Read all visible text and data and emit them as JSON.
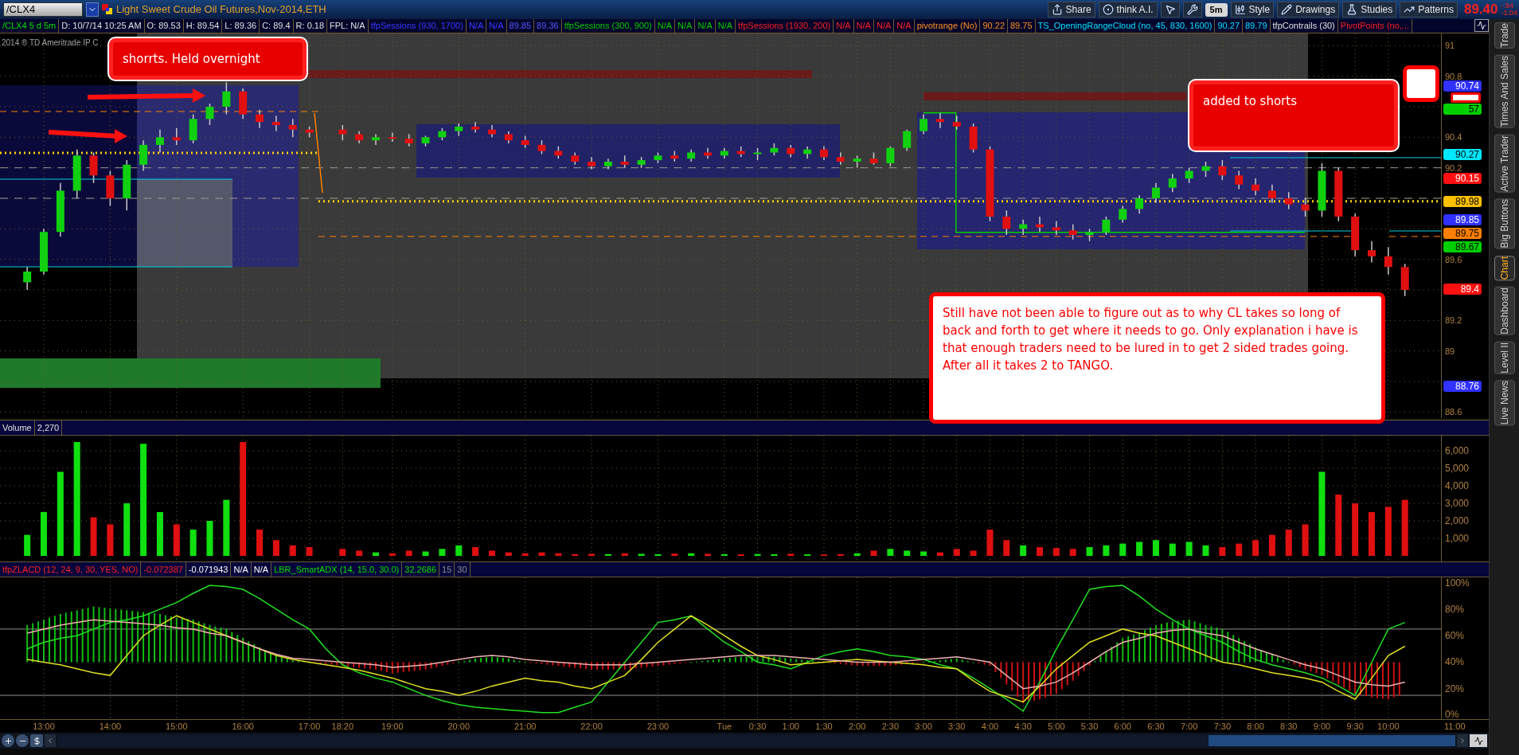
{
  "toolbar": {
    "symbol": "/CLX4",
    "title": "Light Sweet Crude Oil Futures,Nov-2014,ETH",
    "buttons": [
      {
        "kind": "share",
        "label": "Share"
      },
      {
        "kind": "ai",
        "label": "think A.I."
      },
      {
        "kind": "pointer"
      },
      {
        "kind": "wrench"
      },
      {
        "kind": "period",
        "label": "5m"
      },
      {
        "kind": "style",
        "label": "Style"
      },
      {
        "kind": "drawings",
        "label": "Drawings"
      },
      {
        "kind": "studies",
        "label": "Studies"
      },
      {
        "kind": "patterns",
        "label": "Patterns"
      }
    ],
    "last": "89.40",
    "change": "-.94",
    "change_pct": "-1.04"
  },
  "legend": [
    {
      "text": "/CLX4 5 d 5m",
      "kind": "symbol"
    },
    {
      "text": "D: 10/7/14 10:25 AM",
      "kind": "quote"
    },
    {
      "text": "O: 89.53",
      "kind": "quote"
    },
    {
      "text": "H: 89.54",
      "kind": "quote"
    },
    {
      "text": "L: 89.36",
      "kind": "quote"
    },
    {
      "text": "C: 89.4",
      "kind": "quote"
    },
    {
      "text": "R: 0.18",
      "kind": "quote"
    },
    {
      "text": "FPL: N/A",
      "kind": "quote"
    },
    {
      "text": "tfpSessions (930, 1700)",
      "kind": "day_session"
    },
    {
      "text": "N/A",
      "kind": "day_session"
    },
    {
      "text": "N/A",
      "kind": "day_session"
    },
    {
      "text": "89.85",
      "kind": "day_value"
    },
    {
      "text": "89.36",
      "kind": "day_value"
    },
    {
      "text": "tfpSessions (300, 900)",
      "kind": "europe_session"
    },
    {
      "text": "N/A",
      "kind": "europe_session"
    },
    {
      "text": "N/A",
      "kind": "europe_session"
    },
    {
      "text": "N/A",
      "kind": "europe_session"
    },
    {
      "text": "N/A",
      "kind": "europe_session"
    },
    {
      "text": "tfpSessions (1930, 200)",
      "kind": "night_session"
    },
    {
      "text": "N/A",
      "kind": "night_session"
    },
    {
      "text": "N/A",
      "kind": "night_session"
    },
    {
      "text": "N/A",
      "kind": "night_session"
    },
    {
      "text": "N/A",
      "kind": "night_session"
    },
    {
      "text": "pivotrange (No)",
      "kind": "pivot"
    },
    {
      "text": "90.22",
      "kind": "pivot"
    },
    {
      "text": "89.75",
      "kind": "pivot"
    },
    {
      "text": "TS_OpeningRangeCloud (no, 45, 830, 1600)",
      "kind": "range_cloud"
    },
    {
      "text": "90.27",
      "kind": "range_cloud"
    },
    {
      "text": "89.79",
      "kind": "range_cloud"
    },
    {
      "text": "tfpContrails (30)",
      "kind": "quote"
    },
    {
      "text": "PivotPoints (no,...",
      "kind": "night_session"
    }
  ],
  "price_chart": {
    "copyright": "2014 ® TD Ameritrade IP C",
    "chart_data": {
      "type": "candlestick",
      "grid": true,
      "categories": [
        null,
        null,
        null,
        null,
        null,
        null,
        null,
        null,
        null,
        null,
        null,
        null,
        null,
        null,
        null,
        null,
        null,
        null,
        null,
        null,
        null,
        null,
        null,
        null,
        null,
        null,
        null,
        null,
        null,
        null,
        null,
        null,
        null,
        null,
        null,
        null,
        null,
        null,
        null,
        null,
        null,
        null,
        null,
        null,
        null,
        null,
        null,
        null,
        null,
        null,
        null,
        null,
        null,
        null,
        null,
        null,
        null,
        null,
        null,
        null,
        null,
        null,
        null,
        null,
        null,
        null,
        null,
        null,
        null,
        null,
        null,
        null,
        null,
        null,
        null,
        null,
        null,
        null,
        null,
        null,
        null,
        null,
        null,
        null,
        null,
        null,
        null
      ],
      "ohlc": [
        [
          89.45,
          89.55,
          89.4,
          89.52
        ],
        [
          89.52,
          89.8,
          89.5,
          89.78
        ],
        [
          89.78,
          90.1,
          89.75,
          90.05
        ],
        [
          90.05,
          90.32,
          90.0,
          90.28
        ],
        [
          90.28,
          90.3,
          90.1,
          90.15
        ],
        [
          90.15,
          90.18,
          89.95,
          90.0
        ],
        [
          90.0,
          90.25,
          89.92,
          90.22
        ],
        [
          90.22,
          90.38,
          90.18,
          90.35
        ],
        [
          90.35,
          90.45,
          90.3,
          90.4
        ],
        [
          90.4,
          90.46,
          90.35,
          90.38
        ],
        [
          90.38,
          90.55,
          90.36,
          90.52
        ],
        [
          90.52,
          90.62,
          90.48,
          90.6
        ],
        [
          90.6,
          90.76,
          90.55,
          90.7
        ],
        [
          90.7,
          90.72,
          90.52,
          90.55
        ],
        [
          90.55,
          90.58,
          90.46,
          90.5
        ],
        [
          90.5,
          90.54,
          90.44,
          90.48
        ],
        [
          90.48,
          90.52,
          90.4,
          90.45
        ],
        [
          90.45,
          90.47,
          90.4,
          90.43
        ],
        null,
        [
          90.45,
          90.48,
          90.38,
          90.42
        ],
        [
          90.42,
          90.44,
          90.36,
          90.38
        ],
        [
          90.38,
          90.42,
          90.35,
          90.4
        ],
        [
          90.4,
          90.43,
          90.37,
          90.39
        ],
        [
          90.39,
          90.42,
          90.34,
          90.36
        ],
        [
          90.36,
          90.41,
          90.34,
          90.4
        ],
        [
          90.4,
          90.46,
          90.38,
          90.44
        ],
        [
          90.44,
          90.49,
          90.41,
          90.47
        ],
        [
          90.47,
          90.5,
          90.43,
          90.45
        ],
        [
          90.45,
          90.48,
          90.4,
          90.42
        ],
        [
          90.42,
          90.44,
          90.36,
          90.38
        ],
        [
          90.38,
          90.41,
          90.33,
          90.35
        ],
        [
          90.35,
          90.38,
          90.29,
          90.31
        ],
        [
          90.31,
          90.34,
          90.26,
          90.28
        ],
        [
          90.28,
          90.3,
          90.22,
          90.24
        ],
        [
          90.24,
          90.27,
          90.19,
          90.21
        ],
        [
          90.21,
          90.26,
          90.19,
          90.24
        ],
        [
          90.24,
          90.28,
          90.2,
          90.22
        ],
        [
          90.22,
          90.27,
          90.2,
          90.25
        ],
        [
          90.25,
          90.3,
          90.23,
          90.28
        ],
        [
          90.28,
          90.31,
          90.24,
          90.26
        ],
        [
          90.26,
          90.32,
          90.24,
          90.3
        ],
        [
          90.3,
          90.33,
          90.26,
          90.28
        ],
        [
          90.28,
          90.33,
          90.26,
          90.31
        ],
        [
          90.31,
          90.34,
          90.27,
          90.29
        ],
        [
          90.29,
          90.33,
          90.25,
          90.3
        ],
        [
          90.3,
          90.36,
          90.28,
          90.33
        ],
        [
          90.33,
          90.35,
          90.27,
          90.29
        ],
        [
          90.29,
          90.34,
          90.26,
          90.32
        ],
        [
          90.32,
          90.34,
          90.25,
          90.27
        ],
        [
          90.27,
          90.3,
          90.22,
          90.24
        ],
        [
          90.24,
          90.28,
          90.2,
          90.26
        ],
        [
          90.26,
          90.3,
          90.22,
          90.23
        ],
        [
          90.23,
          90.34,
          90.21,
          90.33
        ],
        [
          90.33,
          90.45,
          90.31,
          90.44
        ],
        [
          90.44,
          90.55,
          90.42,
          90.52
        ],
        [
          90.52,
          90.56,
          90.46,
          90.5
        ],
        [
          90.5,
          90.54,
          90.45,
          90.47
        ],
        [
          90.47,
          90.49,
          90.3,
          90.32
        ],
        [
          90.32,
          90.34,
          89.85,
          89.88
        ],
        [
          89.88,
          89.92,
          89.76,
          89.8
        ],
        [
          89.8,
          89.86,
          89.76,
          89.83
        ],
        [
          89.83,
          89.88,
          89.78,
          89.81
        ],
        [
          89.81,
          89.85,
          89.76,
          89.79
        ],
        [
          89.79,
          89.83,
          89.73,
          89.76
        ],
        [
          89.76,
          89.8,
          89.72,
          89.78
        ],
        [
          89.78,
          89.88,
          89.76,
          89.86
        ],
        [
          89.86,
          89.95,
          89.84,
          89.93
        ],
        [
          89.93,
          90.02,
          89.9,
          90.0
        ],
        [
          90.0,
          90.1,
          89.97,
          90.07
        ],
        [
          90.07,
          90.16,
          90.04,
          90.13
        ],
        [
          90.13,
          90.2,
          90.1,
          90.18
        ],
        [
          90.18,
          90.24,
          90.14,
          90.21
        ],
        [
          90.21,
          90.25,
          90.12,
          90.15
        ],
        [
          90.15,
          90.18,
          90.06,
          90.09
        ],
        [
          90.09,
          90.13,
          90.02,
          90.05
        ],
        [
          90.05,
          90.09,
          89.97,
          90.0
        ],
        [
          90.0,
          90.04,
          89.93,
          89.96
        ],
        [
          89.96,
          90.0,
          89.88,
          89.92
        ],
        [
          89.92,
          90.23,
          89.88,
          90.18
        ],
        [
          90.18,
          90.2,
          89.85,
          89.88
        ],
        [
          89.88,
          89.9,
          89.62,
          89.66
        ],
        [
          89.66,
          89.72,
          89.58,
          89.62
        ],
        [
          89.62,
          89.68,
          89.5,
          89.55
        ],
        [
          89.55,
          89.57,
          89.36,
          89.4
        ],
        null,
        null,
        null
      ],
      "ylim": [
        88.56,
        91.08
      ],
      "yticks": [
        {
          "value": 91,
          "label": "91"
        },
        {
          "value": 90.8,
          "label": "90.8"
        },
        {
          "value": 90.4,
          "label": "90.4"
        },
        {
          "value": 90.2,
          "label": "90.2"
        },
        {
          "value": 89.6,
          "label": "89.6"
        },
        {
          "value": 89.2,
          "label": "89.2"
        },
        {
          "value": 89,
          "label": "89"
        },
        {
          "value": 88.6,
          "label": "88.6"
        }
      ]
    },
    "tags": [
      {
        "text": "90.74",
        "color": "#3030ff"
      },
      {
        "text": "57",
        "color": "#00d000"
      },
      {
        "text": "90.27",
        "color": "#00e8ff"
      },
      {
        "text": "90.15",
        "color": "#ff1010"
      },
      {
        "text": "89.98",
        "color": "#ffc000"
      },
      {
        "text": "89.85",
        "color": "#3030ff"
      },
      {
        "text": "89.75",
        "color": "#ff8000"
      },
      {
        "text": "89.67",
        "color": "#00d000"
      },
      {
        "text": "89.4",
        "color": "#ff1010"
      },
      {
        "text": "88.76",
        "color": "#3030ff"
      }
    ]
  },
  "annotations": [
    {
      "kind": "filled",
      "text": "shorrts. Held overnight"
    },
    {
      "kind": "filled",
      "text": "added to shorts"
    },
    {
      "kind": "note",
      "text": "Still have not been able to figure out as to why CL takes so long of back and forth to get where it needs to go. Only explanation i have is that enough traders need to be lured in to get 2 sided trades going. After all it takes 2 to TANGO."
    }
  ],
  "volume": {
    "header": [
      "Volume",
      "2,270"
    ],
    "chart_data": {
      "type": "bar",
      "grid": true,
      "categories": [
        null,
        null,
        null,
        null,
        null,
        null,
        null,
        null,
        null,
        null,
        null,
        null,
        null,
        null,
        null,
        null,
        null,
        null,
        null,
        null,
        null,
        null,
        null,
        null,
        null,
        null,
        null,
        null,
        null,
        null,
        null,
        null,
        null,
        null,
        null,
        null,
        null,
        null,
        null,
        null,
        null,
        null,
        null,
        null,
        null,
        null,
        null,
        null,
        null,
        null,
        null,
        null,
        null,
        null,
        null,
        null,
        null,
        null,
        null,
        null,
        null,
        null,
        null,
        null,
        null,
        null,
        null,
        null,
        null,
        null,
        null,
        null,
        null,
        null,
        null,
        null,
        null,
        null,
        null,
        null,
        null,
        null,
        null,
        null,
        null,
        null,
        null
      ],
      "series": [
        {
          "color": "#10e010",
          "values": [
            1200,
            2500,
            4800,
            6500,
            null,
            null,
            3000,
            6400,
            2500,
            null,
            1500,
            2000,
            3200,
            null,
            null,
            null,
            null,
            null,
            null,
            null,
            null,
            200,
            null,
            null,
            250,
            400,
            600,
            null,
            null,
            null,
            null,
            null,
            null,
            null,
            null,
            100,
            null,
            120,
            100,
            null,
            150,
            null,
            100,
            null,
            110,
            100,
            null,
            90,
            null,
            null,
            150,
            null,
            400,
            300,
            250,
            null,
            null,
            null,
            null,
            null,
            600,
            null,
            null,
            null,
            500,
            600,
            700,
            800,
            900,
            700,
            800,
            600,
            null,
            null,
            null,
            null,
            null,
            null,
            4800,
            null,
            null,
            null,
            null,
            null,
            null,
            null,
            null
          ]
        },
        {
          "color": "#e01010",
          "values": [
            null,
            null,
            null,
            null,
            2200,
            1800,
            null,
            null,
            null,
            1800,
            null,
            null,
            null,
            6500,
            1500,
            900,
            600,
            500,
            null,
            400,
            300,
            null,
            150,
            300,
            null,
            null,
            null,
            500,
            300,
            200,
            150,
            200,
            150,
            100,
            120,
            null,
            150,
            null,
            null,
            130,
            null,
            120,
            null,
            90,
            null,
            null,
            120,
            null,
            80,
            100,
            null,
            300,
            null,
            null,
            null,
            200,
            400,
            300,
            1500,
            900,
            null,
            500,
            450,
            400,
            null,
            null,
            null,
            null,
            null,
            null,
            null,
            null,
            500,
            700,
            900,
            1200,
            1500,
            1800,
            null,
            3500,
            3000,
            2500,
            2800,
            3200,
            null,
            null,
            null
          ]
        }
      ],
      "ylim": [
        0,
        6864
      ],
      "yticks": [
        {
          "value": 6000,
          "label": "6,000"
        },
        {
          "value": 5000,
          "label": "5,000"
        },
        {
          "value": 4000,
          "label": "4,000"
        },
        {
          "value": 3000,
          "label": "3,000"
        },
        {
          "value": 2000,
          "label": "2,000"
        },
        {
          "value": 1000,
          "label": "1,000"
        }
      ]
    }
  },
  "indicator": {
    "header": [
      {
        "text": "tfpZLACD (12, 24, 9, 30, YES, NO)",
        "kind": "night_session"
      },
      {
        "text": "-0.072387",
        "kind": "night_session"
      },
      {
        "text": "-0.071943",
        "kind": "value"
      },
      {
        "text": "N/A",
        "kind": "value"
      },
      {
        "text": "N/A",
        "kind": "value"
      },
      {
        "text": "LBR_SmartADX (14, 15.0, 30.0)",
        "kind": "symbol"
      },
      {
        "text": "32.2686",
        "kind": "symbol"
      },
      {
        "text": "15",
        "kind": "level"
      },
      {
        "text": "30",
        "kind": "level"
      }
    ],
    "chart_data": {
      "type": "line",
      "grid": true,
      "categories": [
        null,
        "13:00",
        null,
        null,
        null,
        "14:00",
        null,
        null,
        null,
        "15:00",
        null,
        null,
        null,
        "16:00",
        null,
        null,
        null,
        "17:00",
        null,
        "18:20",
        null,
        null,
        "19:00",
        null,
        null,
        null,
        "20:00",
        null,
        null,
        null,
        "21:00",
        null,
        null,
        null,
        "22:00",
        null,
        null,
        null,
        "23:00",
        null,
        null,
        null,
        "Tue",
        null,
        "0:30",
        null,
        "1:00",
        null,
        "1:30",
        null,
        "2:00",
        null,
        "2:30",
        null,
        "3:00",
        null,
        "3:30",
        null,
        "4:00",
        null,
        "4:30",
        null,
        "5:00",
        null,
        "5:30",
        null,
        "6:00",
        null,
        "6:30",
        null,
        "7:00",
        null,
        "7:30",
        null,
        "8:00",
        null,
        "8:30",
        null,
        "9:00",
        null,
        "9:30",
        null,
        "10:00",
        null,
        null,
        null,
        "11:00"
      ],
      "series": [
        {
          "color": "#20e020",
          "values": [
            50,
            55,
            58,
            60,
            65,
            70,
            72,
            75,
            80,
            85,
            92,
            98,
            97,
            95,
            88,
            80,
            72,
            65,
            50,
            38,
            32,
            28,
            25,
            20,
            15,
            11,
            8,
            6,
            5,
            4,
            3,
            2,
            2,
            6,
            10,
            25,
            40,
            55,
            70,
            72,
            75,
            65,
            55,
            48,
            40,
            38,
            35,
            40,
            45,
            48,
            50,
            48,
            45,
            44,
            42,
            38,
            35,
            28,
            20,
            12,
            3,
            25,
            50,
            72,
            95,
            97,
            98,
            90,
            80,
            72,
            65,
            60,
            55,
            48,
            42,
            38,
            35,
            32,
            28,
            22,
            15,
            40,
            65,
            70,
            null,
            null,
            null
          ]
        },
        {
          "color": "#e0e020",
          "values": [
            42,
            40,
            38,
            35,
            32,
            30,
            45,
            60,
            68,
            75,
            70,
            65,
            60,
            55,
            50,
            45,
            42,
            40,
            38,
            36,
            34,
            31,
            28,
            24,
            20,
            18,
            15,
            18,
            22,
            25,
            28,
            26,
            25,
            22,
            20,
            25,
            30,
            42,
            55,
            65,
            75,
            68,
            60,
            52,
            45,
            42,
            38,
            39,
            40,
            41,
            42,
            41,
            40,
            39,
            38,
            36,
            35,
            26,
            18,
            14,
            10,
            22,
            35,
            45,
            55,
            60,
            65,
            62,
            60,
            55,
            50,
            45,
            40,
            38,
            35,
            32,
            30,
            28,
            25,
            18,
            12,
            28,
            45,
            52,
            null,
            null,
            null
          ]
        },
        {
          "color": "#f0b0b0",
          "values": [
            62,
            65,
            68,
            70,
            72,
            71,
            70,
            69,
            68,
            66,
            65,
            62,
            60,
            55,
            50,
            46,
            43,
            42,
            41,
            40,
            39,
            38,
            36,
            37,
            38,
            40,
            42,
            44,
            45,
            44,
            42,
            41,
            40,
            39,
            38,
            38,
            38,
            39,
            40,
            41,
            42,
            43,
            44,
            45,
            45,
            45,
            44,
            43,
            42,
            41,
            40,
            40,
            40,
            41,
            42,
            43,
            44,
            42,
            40,
            30,
            20,
            22,
            25,
            32,
            40,
            48,
            55,
            58,
            62,
            64,
            65,
            62,
            60,
            55,
            50,
            46,
            42,
            38,
            35,
            30,
            25,
            23,
            22,
            25,
            null,
            null,
            null
          ]
        }
      ],
      "ylim": [
        -3,
        104
      ],
      "yticks": [
        {
          "value": 100,
          "label": "100%"
        },
        {
          "value": 80,
          "label": "80%"
        },
        {
          "value": 60,
          "label": "60%"
        },
        {
          "value": 40,
          "label": "40%"
        },
        {
          "value": 20,
          "label": "20%"
        },
        {
          "value": 0,
          "label": "0%"
        }
      ]
    }
  },
  "side_tabs": [
    {
      "label": "Trade",
      "selected": false
    },
    {
      "label": "Times And Sales",
      "selected": false
    },
    {
      "label": "Active Trader",
      "selected": false
    },
    {
      "label": "Big Buttons",
      "selected": false
    },
    {
      "label": "Chart",
      "selected": true
    },
    {
      "label": "Dashboard",
      "selected": false
    },
    {
      "label": "Level II",
      "selected": false
    },
    {
      "label": "Live News",
      "selected": false
    }
  ]
}
